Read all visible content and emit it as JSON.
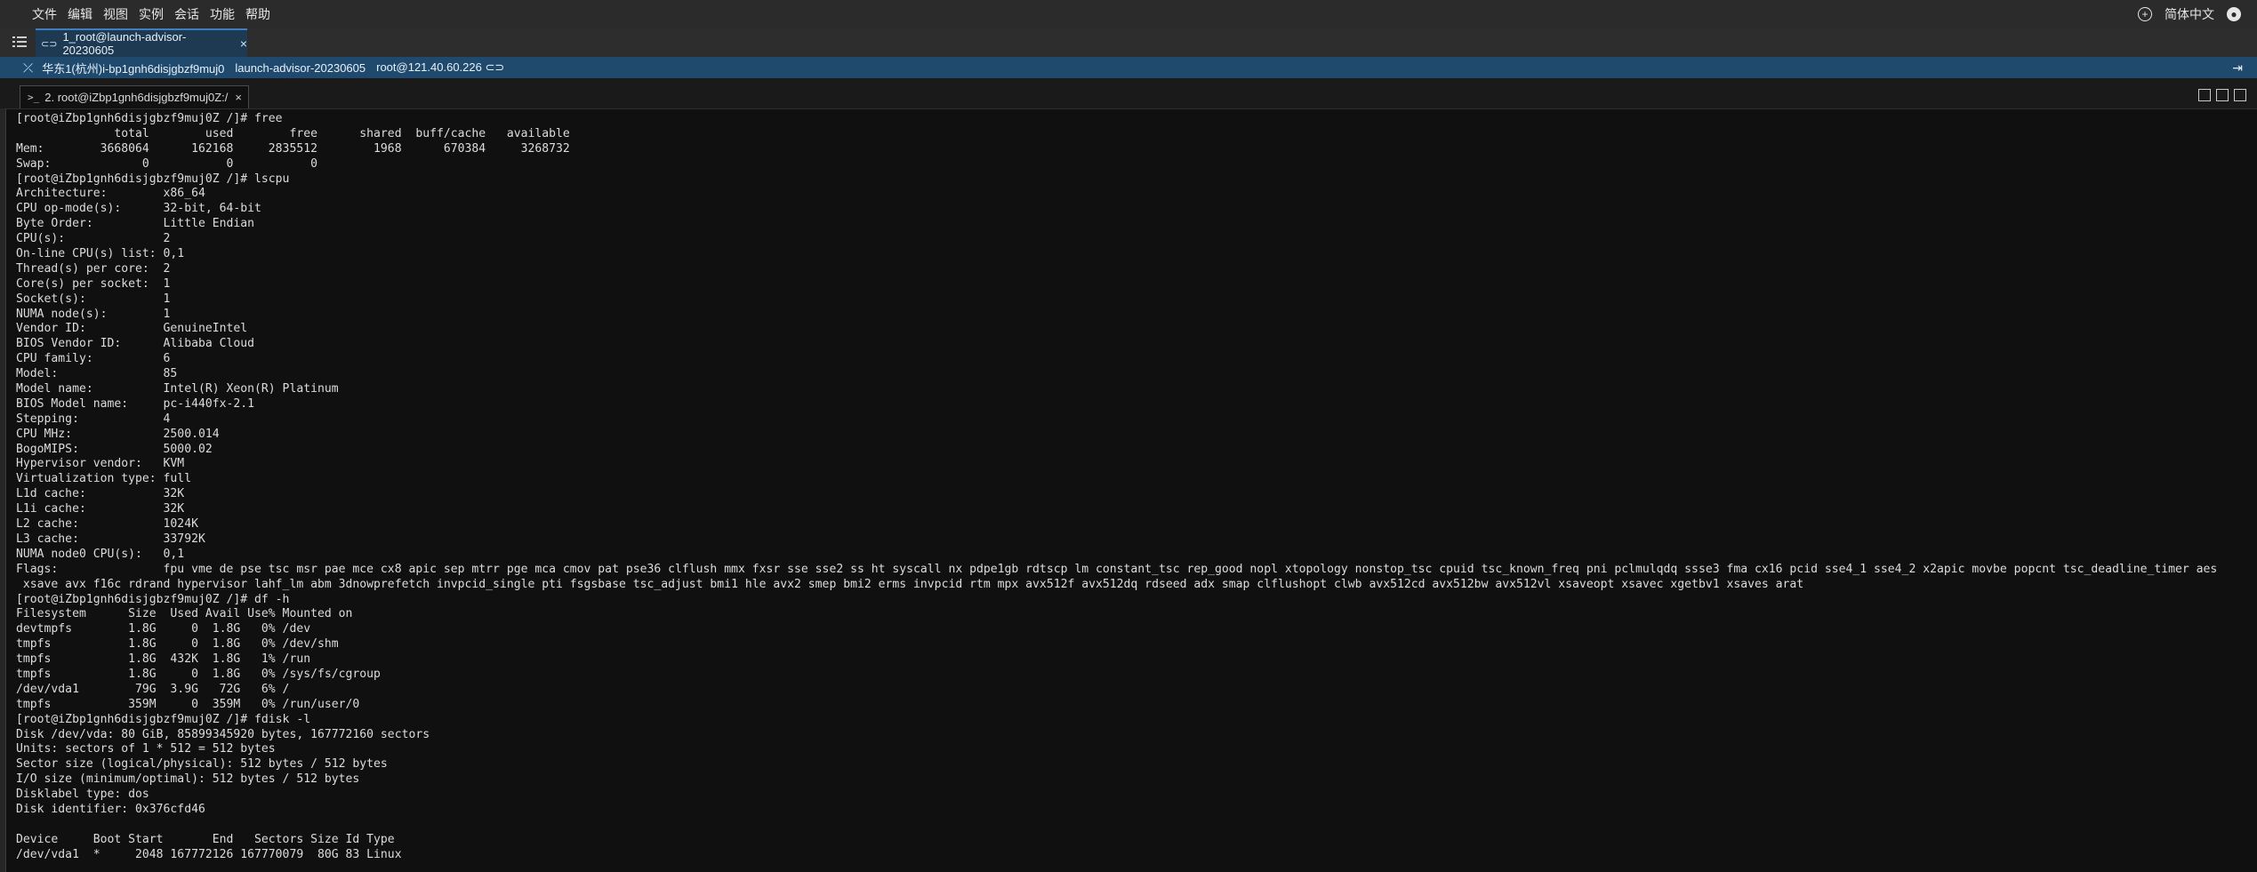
{
  "menubar": {
    "items": [
      "文件",
      "编辑",
      "视图",
      "实例",
      "会话",
      "功能",
      "帮助"
    ],
    "language": "简体中文",
    "icons": [
      "add-circle-icon",
      "user-avatar-icon"
    ]
  },
  "session_tab": {
    "label": "1_root@launch-advisor-20230605",
    "close": "×"
  },
  "infobar": {
    "region": "华东1(杭州)i-bp1gnh6disjgbzf9muj0",
    "instance_name": "launch-advisor-20230605",
    "address": "root@121.40.60.226"
  },
  "terminal_tab": {
    "prefix": ">_",
    "label": "2. root@iZbp1gnh6disjgbzf9muj0Z:/",
    "close": "×"
  },
  "terminal": {
    "lines": [
      "[root@iZbp1gnh6disjgbzf9muj0Z /]# free",
      "              total        used        free      shared  buff/cache   available",
      "Mem:        3668064      162168     2835512        1968      670384     3268732",
      "Swap:             0           0           0",
      "[root@iZbp1gnh6disjgbzf9muj0Z /]# lscpu",
      "Architecture:        x86_64",
      "CPU op-mode(s):      32-bit, 64-bit",
      "Byte Order:          Little Endian",
      "CPU(s):              2",
      "On-line CPU(s) list: 0,1",
      "Thread(s) per core:  2",
      "Core(s) per socket:  1",
      "Socket(s):           1",
      "NUMA node(s):        1",
      "Vendor ID:           GenuineIntel",
      "BIOS Vendor ID:      Alibaba Cloud",
      "CPU family:          6",
      "Model:               85",
      "Model name:          Intel(R) Xeon(R) Platinum",
      "BIOS Model name:     pc-i440fx-2.1",
      "Stepping:            4",
      "CPU MHz:             2500.014",
      "BogoMIPS:            5000.02",
      "Hypervisor vendor:   KVM",
      "Virtualization type: full",
      "L1d cache:           32K",
      "L1i cache:           32K",
      "L2 cache:            1024K",
      "L3 cache:            33792K",
      "NUMA node0 CPU(s):   0,1",
      "Flags:               fpu vme de pse tsc msr pae mce cx8 apic sep mtrr pge mca cmov pat pse36 clflush mmx fxsr sse sse2 ss ht syscall nx pdpe1gb rdtscp lm constant_tsc rep_good nopl xtopology nonstop_tsc cpuid tsc_known_freq pni pclmulqdq ssse3 fma cx16 pcid sse4_1 sse4_2 x2apic movbe popcnt tsc_deadline_timer aes",
      " xsave avx f16c rdrand hypervisor lahf_lm abm 3dnowprefetch invpcid_single pti fsgsbase tsc_adjust bmi1 hle avx2 smep bmi2 erms invpcid rtm mpx avx512f avx512dq rdseed adx smap clflushopt clwb avx512cd avx512bw avx512vl xsaveopt xsavec xgetbv1 xsaves arat",
      "[root@iZbp1gnh6disjgbzf9muj0Z /]# df -h",
      "Filesystem      Size  Used Avail Use% Mounted on",
      "devtmpfs        1.8G     0  1.8G   0% /dev",
      "tmpfs           1.8G     0  1.8G   0% /dev/shm",
      "tmpfs           1.8G  432K  1.8G   1% /run",
      "tmpfs           1.8G     0  1.8G   0% /sys/fs/cgroup",
      "/dev/vda1        79G  3.9G   72G   6% /",
      "tmpfs           359M     0  359M   0% /run/user/0",
      "[root@iZbp1gnh6disjgbzf9muj0Z /]# fdisk -l",
      "Disk /dev/vda: 80 GiB, 85899345920 bytes, 167772160 sectors",
      "Units: sectors of 1 * 512 = 512 bytes",
      "Sector size (logical/physical): 512 bytes / 512 bytes",
      "I/O size (minimum/optimal): 512 bytes / 512 bytes",
      "Disklabel type: dos",
      "Disk identifier: 0x376cfd46",
      "",
      "Device     Boot Start       End   Sectors Size Id Type",
      "/dev/vda1  *     2048 167772126 167770079  80G 83 Linux"
    ]
  }
}
